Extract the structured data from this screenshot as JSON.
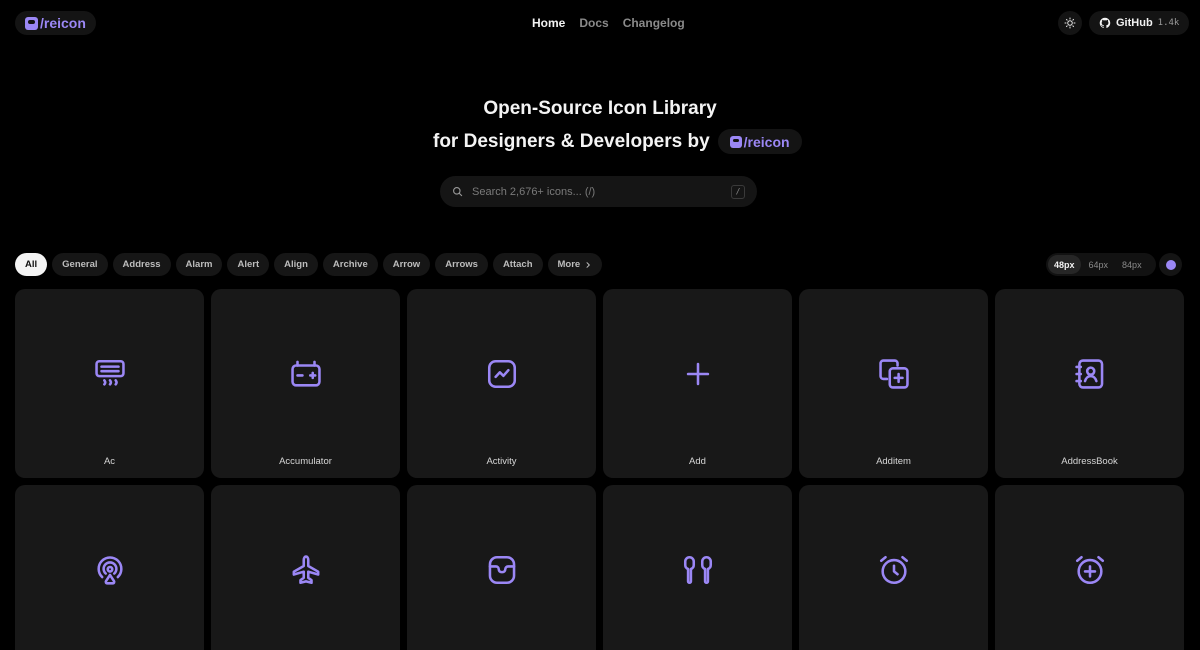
{
  "brand": {
    "name": "/reicon"
  },
  "nav": {
    "home": "Home",
    "docs": "Docs",
    "changelog": "Changelog"
  },
  "github": {
    "label": "GitHub",
    "stars": "1.4k"
  },
  "hero": {
    "line1": "Open-Source Icon Library",
    "line2": "for Designers & Developers by",
    "badge": "/reicon"
  },
  "search": {
    "placeholder": "Search 2,676+ icons... (/)",
    "shortcut": "/"
  },
  "filters": [
    "All",
    "General",
    "Address",
    "Alarm",
    "Alert",
    "Align",
    "Archive",
    "Arrow",
    "Arrows",
    "Attach"
  ],
  "more_label": "More",
  "sizes": [
    "48px",
    "64px",
    "84px"
  ],
  "selected_size": "48px",
  "accent_color": "#9b87f5",
  "icons": [
    {
      "name": "Ac",
      "icon": "air-conditioner-icon"
    },
    {
      "name": "Accumulator",
      "icon": "battery-accumulator-icon"
    },
    {
      "name": "Activity",
      "icon": "activity-chart-icon"
    },
    {
      "name": "Add",
      "icon": "plus-icon"
    },
    {
      "name": "Additem",
      "icon": "add-item-icon"
    },
    {
      "name": "AddressBook",
      "icon": "address-book-icon"
    },
    {
      "name": "",
      "icon": "airdrop-icon"
    },
    {
      "name": "",
      "icon": "airplane-icon"
    },
    {
      "name": "",
      "icon": "airpods-case-icon"
    },
    {
      "name": "",
      "icon": "airpods-icon"
    },
    {
      "name": "",
      "icon": "alarm-icon"
    },
    {
      "name": "",
      "icon": "alarm-add-icon"
    }
  ]
}
